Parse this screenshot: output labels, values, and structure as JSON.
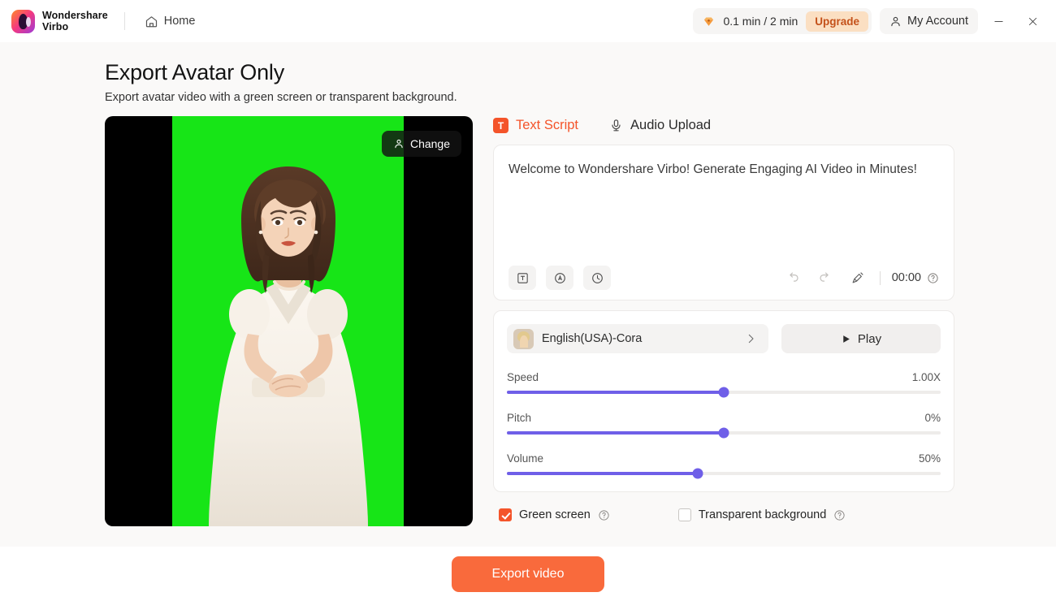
{
  "titlebar": {
    "brand_line1": "Wondershare",
    "brand_line2": "Virbo",
    "home_label": "Home",
    "usage_text": "0.1 min / 2 min",
    "upgrade_label": "Upgrade",
    "account_label": "My Account",
    "minimize_label": "—",
    "close_label": "✕",
    "icons": {
      "home": "home-icon",
      "diamond": "diamond-icon",
      "person": "person-icon",
      "minimize": "minimize-icon",
      "close": "close-icon"
    }
  },
  "page": {
    "title": "Export Avatar Only",
    "subtitle": "Export avatar video with a green screen or transparent background."
  },
  "preview": {
    "change_label": "Change",
    "change_icon": "person-icon",
    "background_color": "#17e517",
    "letterbox_color": "#000000"
  },
  "tabs": [
    {
      "label": "Text Script",
      "icon": "text-badge-icon",
      "active": true
    },
    {
      "label": "Audio Upload",
      "icon": "microphone-icon",
      "active": false
    }
  ],
  "script": {
    "text": "Welcome to Wondershare Virbo! Generate Engaging AI Video in Minutes!",
    "tools": [
      {
        "name": "text-style-button",
        "icon": "t-in-box-icon"
      },
      {
        "name": "pronunciation-button",
        "icon": "a-in-circle-icon"
      },
      {
        "name": "pause-button",
        "icon": "clock-icon"
      }
    ],
    "undo_icon": "undo-icon",
    "redo_icon": "redo-icon",
    "clear_icon": "brush-icon",
    "duration": "00:00",
    "help_icon": "help-icon"
  },
  "voice": {
    "name": "English(USA)-Cora",
    "chevron_icon": "chevron-right-icon",
    "play_label": "Play",
    "play_icon": "play-icon"
  },
  "sliders": [
    {
      "label": "Speed",
      "value": "1.00X",
      "percent": 50
    },
    {
      "label": "Pitch",
      "value": "0%",
      "percent": 50
    },
    {
      "label": "Volume",
      "value": "50%",
      "percent": 44
    }
  ],
  "options": [
    {
      "label": "Green screen",
      "checked": true,
      "help_icon": "help-icon"
    },
    {
      "label": "Transparent background",
      "checked": false,
      "help_icon": "help-icon"
    }
  ],
  "footer": {
    "export_label": "Export video"
  },
  "colors": {
    "accent_orange": "#f4542a",
    "export_orange": "#f96a3c",
    "slider_purple": "#6f5fe8",
    "upgrade_bg": "#fbdfc2",
    "upgrade_text": "#c4511a",
    "content_bg": "#faf9f8"
  }
}
